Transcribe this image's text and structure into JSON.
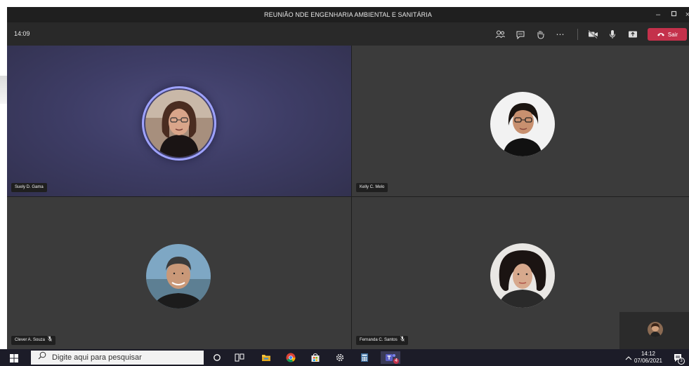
{
  "window": {
    "title": "REUNIÃO NDE ENGENHARIA AMBIENTAL E SANITÁRIA",
    "controls": [
      "minimize-icon",
      "restore-icon",
      "close-icon"
    ]
  },
  "callbar": {
    "time": "14:09",
    "leave_label": "Sair",
    "icons": [
      "participants-icon",
      "chat-icon",
      "raise-hand-icon",
      "more-icon",
      "camera-off-icon",
      "microphone-icon",
      "share-screen-icon",
      "phone-hangup-icon"
    ]
  },
  "participants": [
    {
      "name": "Suely D. Gama",
      "speaking": true,
      "muted": false
    },
    {
      "name": "Kelly C. Melo",
      "speaking": false,
      "muted": false
    },
    {
      "name": "Clever A. Souza",
      "speaking": false,
      "muted": true
    },
    {
      "name": "Fernanda C. Santos",
      "speaking": false,
      "muted": true
    }
  ],
  "taskbar": {
    "search_placeholder": "Digite aqui para pesquisar",
    "time": "14:12",
    "date": "07/06/2021",
    "notification_count": "3",
    "teams_badge": "4",
    "icons": [
      "windows-start-icon",
      "search-icon",
      "cortana-icon",
      "task-view-icon",
      "file-explorer-icon",
      "chrome-icon",
      "store-icon",
      "settings-icon",
      "calculator-icon",
      "teams-icon",
      "tray-chevron-icon",
      "notification-icon"
    ]
  },
  "colors": {
    "accent_ring": "#9ea2ff",
    "leave_button": "#c4314b",
    "tile_bg": "#3b3b3b",
    "speaking_tile_bg": "#3e3d66"
  }
}
